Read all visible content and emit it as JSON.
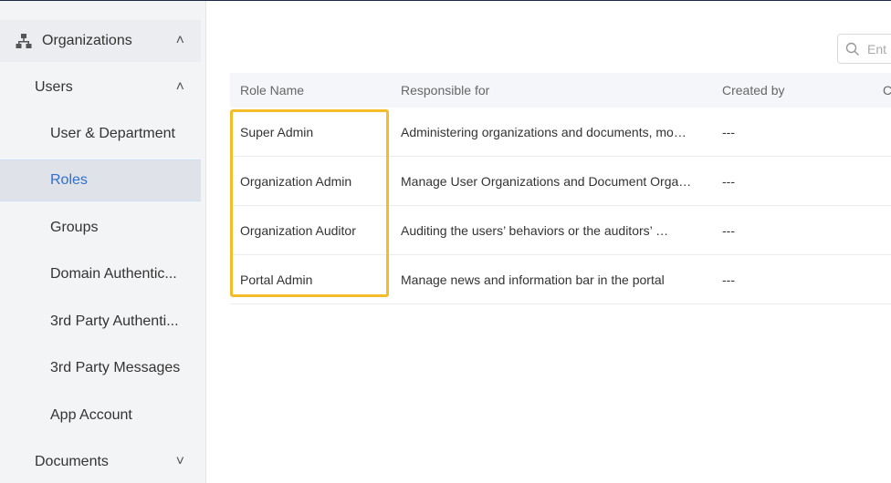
{
  "sidebar": {
    "items": [
      {
        "label": "Organizations",
        "chevron": "˄"
      },
      {
        "label": "Users",
        "chevron": "˄"
      },
      {
        "label": "User & Department"
      },
      {
        "label": "Roles"
      },
      {
        "label": "Groups"
      },
      {
        "label": "Domain Authentic..."
      },
      {
        "label": "3rd Party Authenti..."
      },
      {
        "label": "3rd Party Messages"
      },
      {
        "label": "App Account"
      },
      {
        "label": "Documents",
        "chevron": "˅"
      }
    ]
  },
  "search": {
    "placeholder": "Ent"
  },
  "table": {
    "headers": [
      "Role Name",
      "Responsible for",
      "Created by",
      "C"
    ],
    "rows": [
      {
        "role": "Super Admin",
        "responsible": "Administering organizations and documents, mo…",
        "created_by": "---"
      },
      {
        "role": "Organization Admin",
        "responsible": "Manage User Organizations and Document Orga…",
        "created_by": "---"
      },
      {
        "role": "Organization Auditor",
        "responsible": "Auditing the users’  behaviors or the auditors’  …",
        "created_by": "---"
      },
      {
        "role": "Portal Admin",
        "responsible": "Manage news and information bar in the portal",
        "created_by": "---"
      }
    ]
  },
  "colors": {
    "accent": "#2f6fd1",
    "highlight": "#f5bc2a"
  }
}
